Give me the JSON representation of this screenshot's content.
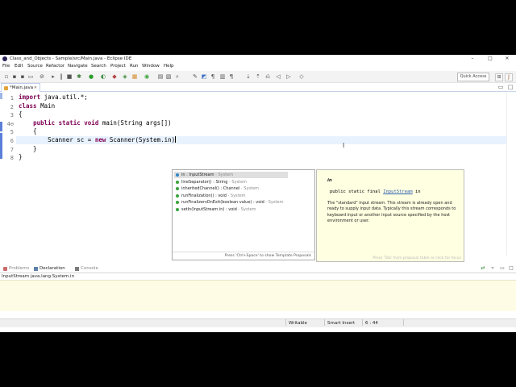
{
  "window": {
    "title": "Class_and_Objects - Sample/src/Main.java - Eclipse IDE",
    "controls": [
      "–",
      "□",
      "✕"
    ]
  },
  "menu": [
    "File",
    "Edit",
    "Source",
    "Refactor",
    "Navigate",
    "Search",
    "Project",
    "Run",
    "Window",
    "Help"
  ],
  "toolbar": {
    "quick_access": "Quick Access"
  },
  "editor": {
    "tab_label": "*Main.java",
    "line_numbers": [
      "1",
      "2",
      "3",
      "4⊖",
      "5",
      "6",
      "7",
      "8"
    ],
    "lines": {
      "l1_kw": "import",
      "l1_rest": " java.util.*;",
      "l2_kw": "class",
      "l2_rest": " Main",
      "l3": "{",
      "l4_indent": "    ",
      "l4_kw1": "public",
      "l4_sp1": " ",
      "l4_kw2": "static",
      "l4_sp2": " ",
      "l4_kw3": "void",
      "l4_rest": " main(String args[])",
      "l5": "    {",
      "l6_pre": "        Scanner sc = ",
      "l6_kw": "new",
      "l6_rest": " Scanner(System.in)",
      "l7": "    }",
      "l8": "}"
    }
  },
  "completion": {
    "items": [
      {
        "name": "in : InputStream",
        "owner": " - System",
        "color": "#2f86c6"
      },
      {
        "name": "lineSeparator() : String",
        "owner": " - System",
        "color": "#39a33a"
      },
      {
        "name": "inheritedChannel() : Channel",
        "owner": " - System",
        "color": "#39a33a"
      },
      {
        "name": "runFinalization() : void",
        "owner": " - System",
        "color": "#39a33a"
      },
      {
        "name": "runFinalizersOnExit(boolean value) : void",
        "owner": " - System",
        "color": "#39a33a"
      },
      {
        "name": "setIn(InputStream in) : void",
        "owner": " - System",
        "color": "#39a33a"
      }
    ],
    "footer": "Press 'Ctrl+Space' to show Template Proposals"
  },
  "javadoc": {
    "name": "in",
    "sig_prefix": "public static final ",
    "sig_type": "InputStream",
    "sig_suffix": " in",
    "description": "The \"standard\" input stream. This stream is already open and ready to supply input data. Typically this stream corresponds to keyboard input or another input source specified by the host environment or user.",
    "footer": "Press 'Tab' from proposal table or click for focus"
  },
  "bottom_panel": {
    "tabs": [
      "Problems",
      "Declaration",
      "Console"
    ],
    "declaration_text": "InputStream java.lang.System.in"
  },
  "status": {
    "mode": "Writable",
    "insert": "Smart Insert",
    "position": "6 : 44"
  }
}
